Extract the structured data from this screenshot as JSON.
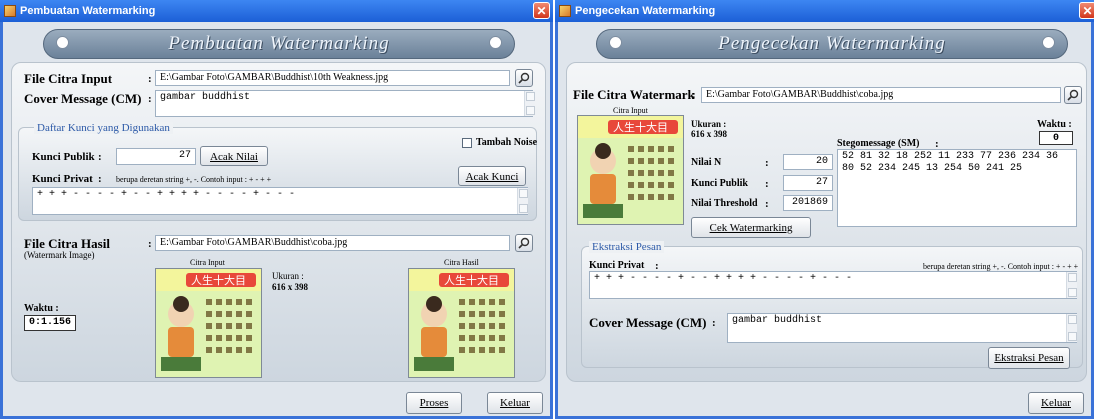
{
  "left": {
    "title": "Pembuatan Watermarking",
    "banner": "Pembuatan Watermarking",
    "file_input_label": "File Citra Input",
    "file_input_value": "E:\\Gambar Foto\\GAMBAR\\Buddhist\\10th Weakness.jpg",
    "cover_label": "Cover Message (CM)",
    "cover_value": "gambar buddhist",
    "group_title": "Daftar Kunci yang Digunakan",
    "tambah_noise": "Tambah Noise",
    "kunci_publik_label": "Kunci Publik",
    "kunci_publik_value": "27",
    "acak_nilai": "Acak Nilai",
    "acak_kunci": "Acak Kunci",
    "kunci_privat_label": "Kunci Privat",
    "kunci_privat_hint": "berupa deretan string +, -. Contoh input : + - + +",
    "kunci_privat_value": "+ + + - - - - + - - + + + + - - - - + - - -",
    "hasil_label": "File Citra Hasil",
    "hasil_sub": "(Watermark Image)",
    "hasil_value": "E:\\Gambar Foto\\GAMBAR\\Buddhist\\coba.jpg",
    "citra_input_caption": "Citra Input",
    "ukuran_label": "Ukuran :",
    "ukuran_value": "616 x 398",
    "citra_hasil_caption": "Citra Hasil",
    "waktu_label": "Waktu :",
    "waktu_value": "0:1.156",
    "proses": "Proses",
    "keluar": "Keluar",
    "colon": ":"
  },
  "right": {
    "title": "Pengecekan Watermarking",
    "banner": "Pengecekan Watermarking",
    "file_label": "File Citra Watermark",
    "file_value": "E:\\Gambar Foto\\GAMBAR\\Buddhist\\coba.jpg",
    "citra_input_caption": "Citra Input",
    "ukuran_label": "Ukuran :",
    "ukuran_value": "616 x 398",
    "waktu_label": "Waktu :",
    "waktu_value": "0",
    "stego_label": "Stegomessage (SM)",
    "stego_value": "52 81 32 18 252 11 233 77 236 234 36 80 52 234 245 13 254 50 241 25",
    "nilai_n_label": "Nilai N",
    "nilai_n_value": "20",
    "kunci_publik_label": "Kunci Publik",
    "kunci_publik_value": "27",
    "threshold_label": "Nilai Threshold",
    "threshold_value": "201869",
    "cek_button": "Cek Watermarking",
    "ekstraksi_title": "Ekstraksi Pesan",
    "kunci_privat_label": "Kunci Privat",
    "kunci_privat_hint": "berupa deretan string +, -. Contoh input : + - + +",
    "kunci_privat_value": "+ + + - - - - + - - + + + + - - - - + - - -",
    "cover_label": "Cover Message (CM)",
    "cover_value": "gambar buddhist",
    "ekstraksi_button": "Ekstraksi Pesan",
    "keluar": "Keluar",
    "colon": ":"
  },
  "image_glyphs": "人生十大目",
  "icons": [
    "app-icon",
    "close-icon",
    "search-icon"
  ]
}
